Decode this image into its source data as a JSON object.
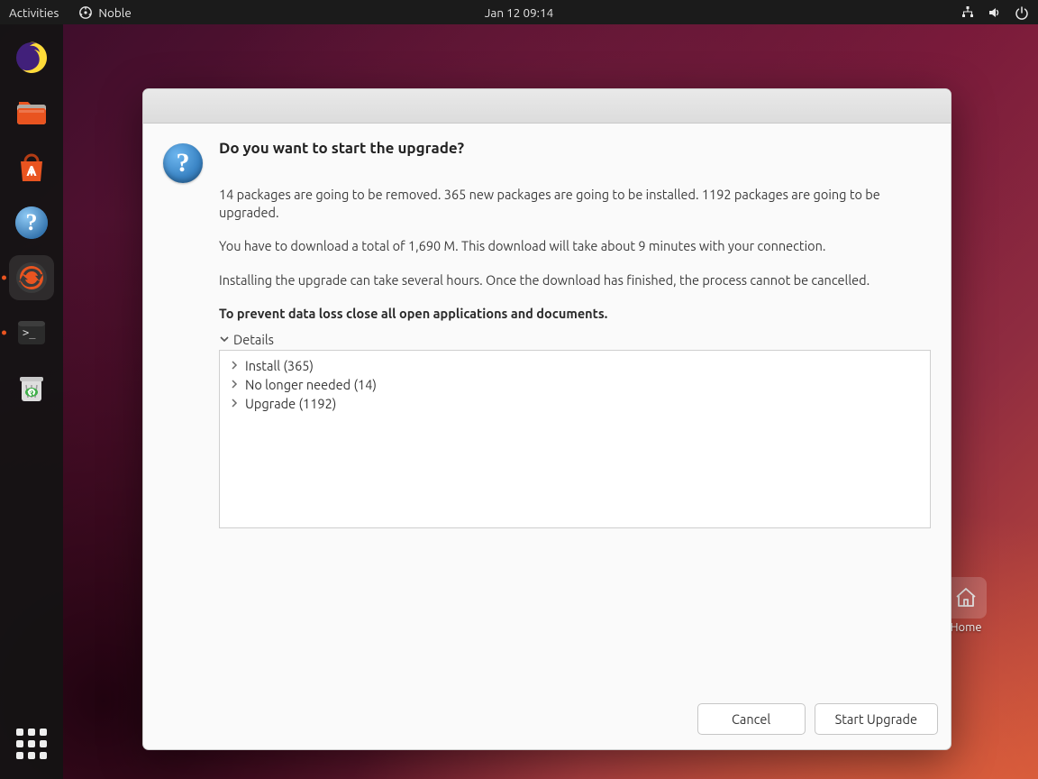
{
  "topbar": {
    "activities": "Activities",
    "app_name": "Noble",
    "clock": "Jan 12  09:14"
  },
  "dock": {
    "items": [
      {
        "name": "firefox-icon"
      },
      {
        "name": "files-icon"
      },
      {
        "name": "ubuntu-software-icon"
      },
      {
        "name": "help-icon"
      },
      {
        "name": "software-updater-icon",
        "active": true,
        "running": true
      },
      {
        "name": "terminal-icon",
        "running": true
      },
      {
        "name": "trash-icon"
      }
    ]
  },
  "desktop": {
    "home_label": "Home"
  },
  "dialog": {
    "title": "Do you want to start the upgrade?",
    "summary": "14 packages are going to be removed. 365 new packages are going to be installed. 1192 packages are going to be upgraded.",
    "download": "You have to download a total of 1,690 M. This download will take about 9 minutes with your connection.",
    "duration": "Installing the upgrade can take several hours. Once the download has finished, the process cannot be cancelled.",
    "warning": "To prevent data loss close all open applications and documents.",
    "details_label": "Details",
    "details_rows": [
      "Install (365)",
      "No longer needed (14)",
      "Upgrade (1192)"
    ],
    "cancel": "Cancel",
    "start": "Start Upgrade"
  }
}
